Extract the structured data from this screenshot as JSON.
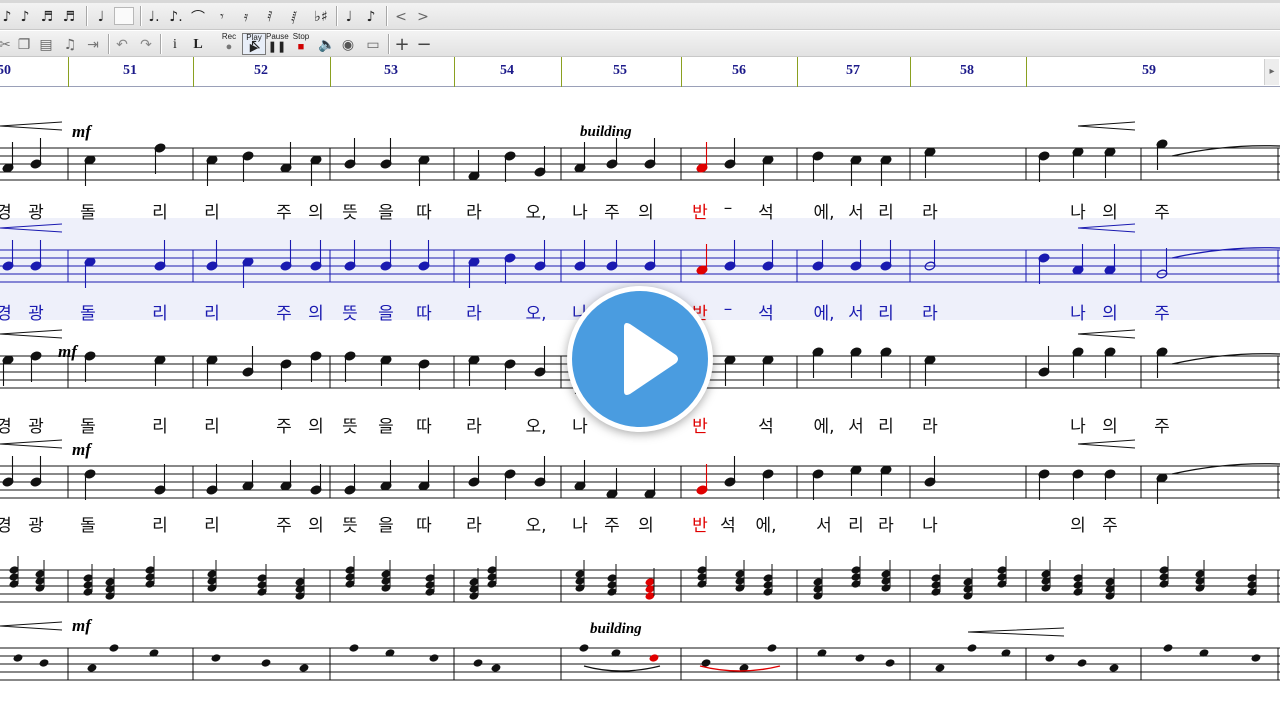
{
  "toolbar": {
    "row1_icons": [
      "quarter-note-icon",
      "eighth-note-icon",
      "sixteenth-note-icon",
      "thirtysecond-note-icon",
      "blank-box-icon",
      "dotted-quarter-icon",
      "dotted-eighth-icon",
      "tie-icon",
      "quarter-rest-icon",
      "eighth-rest-icon",
      "sixteenth-rest-icon",
      "thirtysecond-rest-icon",
      "flat-sharp-icon",
      "small-note-icon",
      "grace-note-icon"
    ],
    "row1_glyphs": [
      "♩",
      "♪",
      "♬",
      "♬",
      "",
      "♩.",
      "♪.",
      "⌒",
      "𝄾",
      "𝄿",
      "𝅀",
      "𝅁",
      "♭♯",
      "♩",
      "♪"
    ],
    "nav_left": "<",
    "nav_right": ">",
    "rec_label": "Rec",
    "play_label": "Play",
    "pause_label": "Pause",
    "stop_label": "Stop"
  },
  "ruler": {
    "bar_numbers": [
      "50",
      "51",
      "52",
      "53",
      "54",
      "55",
      "56",
      "57",
      "58",
      "59"
    ]
  },
  "score": {
    "tempo_marking": "building",
    "dynamic_mark": "mf",
    "lyrics_line": [
      "경",
      "광",
      "돌",
      "리",
      "리",
      "주",
      "의",
      "뜻",
      "을",
      "따",
      "라",
      "오,",
      "나",
      "주",
      "의",
      "반",
      "–",
      "석",
      "에,",
      "서",
      "리",
      "라",
      "나",
      "의",
      "주"
    ],
    "lyrics_line_2": [
      "경",
      "광",
      "돌",
      "리",
      "리",
      "주",
      "의",
      "뜻",
      "을",
      "따",
      "라",
      "오,",
      "나",
      "반",
      "–",
      "석",
      "에,",
      "서",
      "리",
      "라",
      "나",
      "의",
      "주"
    ],
    "lyrics_line_3": [
      "경",
      "광",
      "돌",
      "리",
      "리",
      "주",
      "의",
      "뜻",
      "을",
      "따",
      "라",
      "오,",
      "나",
      "반",
      "석",
      "에,",
      "서",
      "리",
      "라",
      "나",
      "의",
      "주"
    ],
    "lyrics_line_4": [
      "경",
      "광",
      "돌",
      "리",
      "리",
      "주",
      "의",
      "뜻",
      "을",
      "따",
      "라",
      "오,",
      "나",
      "주",
      "의",
      "반",
      "석",
      "에,",
      "서",
      "리",
      "라",
      "나",
      "의",
      "주"
    ]
  },
  "colors": {
    "accent_red": "#e00000",
    "selected_staff_blue": "#1a1ab0",
    "bar_number_blue": "#1c1a8a",
    "play_button": "#4a9ce0"
  }
}
